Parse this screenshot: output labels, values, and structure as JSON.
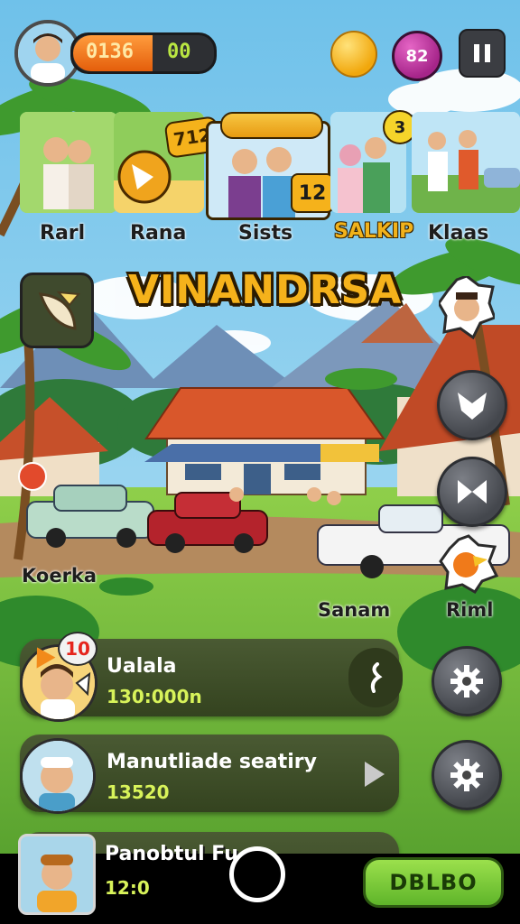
{
  "hud": {
    "coins": "0136",
    "gems": "00",
    "badge_count": "82",
    "pause_icon": "pause-icon",
    "coin_icon": "gold-coin-icon"
  },
  "carousel": [
    {
      "label": "Rarl"
    },
    {
      "label": "Rana",
      "badge": "712"
    },
    {
      "label": "Sists",
      "badge": "12"
    },
    {
      "label": "SALKIP",
      "badge": "3"
    },
    {
      "label": "Klaas"
    }
  ],
  "game_title": "VINANDRSA",
  "map_labels": {
    "left": "Koerka",
    "center": "Sanam",
    "right": "Riml"
  },
  "list": [
    {
      "title": "Ualala",
      "time": "130:000n",
      "badge": "10",
      "action_icon": "key-icon"
    },
    {
      "title": "Manutliade seatiry",
      "time": "13520",
      "action_icon": "play-arrow-icon"
    },
    {
      "title": "Panobtul Fu",
      "time": "12:0"
    }
  ],
  "bottom": {
    "button_label": "DBLBO",
    "capture_icon": "shutter-icon"
  },
  "colors": {
    "accent_orange": "#ff7a1a",
    "title_yellow": "#f5b21b",
    "button_green": "#7fd33b",
    "badge_magenta": "#c53aa7"
  }
}
